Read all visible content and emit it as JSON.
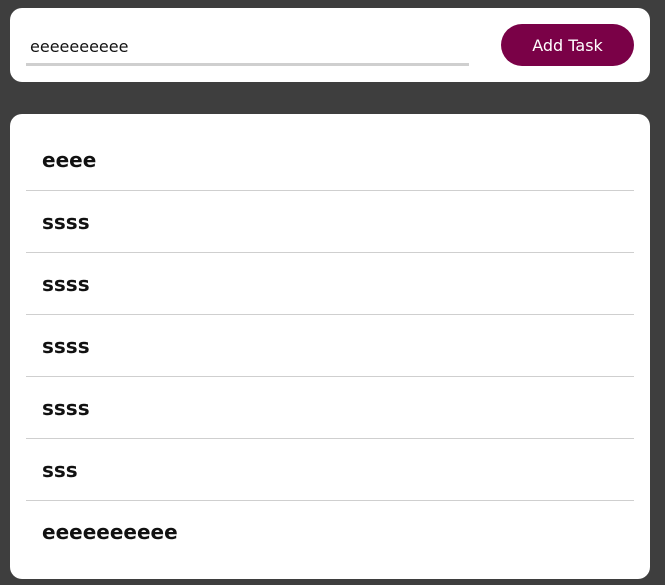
{
  "input": {
    "value": "eeeeeeeeee",
    "placeholder": ""
  },
  "add_button": {
    "label": "Add Task"
  },
  "colors": {
    "background": "#3e3e3e",
    "button": "#7a0147"
  },
  "tasks": [
    "eeee",
    "ssss",
    "ssss",
    "ssss",
    "ssss",
    "sss",
    "eeeeeeeeee"
  ]
}
